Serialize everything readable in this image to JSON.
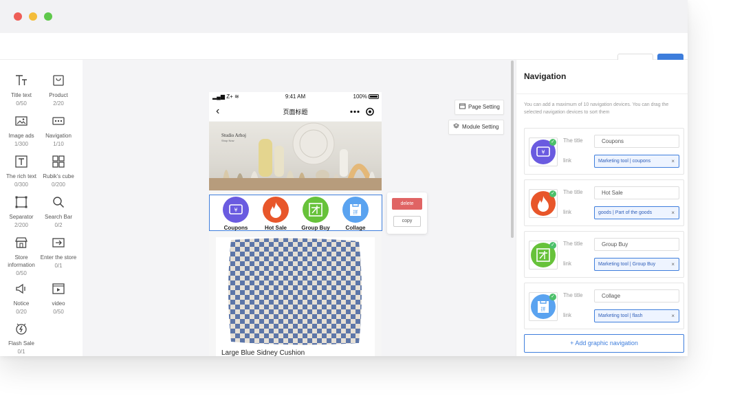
{
  "left_panel": {
    "components": [
      {
        "label": "Title text",
        "count": "0/50",
        "icon": "title-text-icon"
      },
      {
        "label": "Product",
        "count": "2/20",
        "icon": "product-icon"
      },
      {
        "label": "Image ads",
        "count": "1/300",
        "icon": "image-ads-icon"
      },
      {
        "label": "Navigation",
        "count": "1/10",
        "icon": "navigation-icon"
      },
      {
        "label": "The rich text",
        "count": "0/300",
        "icon": "rich-text-icon"
      },
      {
        "label": "Rubik's cube",
        "count": "0/200",
        "icon": "rubiks-cube-icon"
      },
      {
        "label": "Separator",
        "count": "2/200",
        "icon": "separator-icon"
      },
      {
        "label": "Search Bar",
        "count": "0/2",
        "icon": "search-icon"
      },
      {
        "label": "Store information",
        "count": "0/50",
        "icon": "store-icon"
      },
      {
        "label": "Enter the store",
        "count": "0/1",
        "icon": "enter-store-icon"
      },
      {
        "label": "Notice",
        "count": "0/20",
        "icon": "notice-icon"
      },
      {
        "label": "video",
        "count": "0/50",
        "icon": "video-icon"
      },
      {
        "label": "Flash Sale",
        "count": "0/1",
        "icon": "flash-sale-icon"
      }
    ]
  },
  "phone": {
    "status": {
      "signal": "Z+",
      "time": "9:41 AM",
      "battery": "100%"
    },
    "page_title": "页面标题",
    "banner": {
      "brand": "Studio Arhoj",
      "brand_sub": "Shop Now"
    },
    "nav_items": [
      {
        "label": "Coupons",
        "color": "#6a5be0",
        "glyph": "券"
      },
      {
        "label": "Hot Sale",
        "color": "#e8562a",
        "glyph": "🔥"
      },
      {
        "label": "Group Buy",
        "color": "#67c23a",
        "glyph": "团"
      },
      {
        "label": "Collage",
        "color": "#5aa3f0",
        "glyph": "拼"
      }
    ],
    "product": {
      "name": "Large Blue Sidney Cushion"
    }
  },
  "actions": {
    "delete": "delete",
    "copy": "copy"
  },
  "side_buttons": {
    "page_setting": "Page Setting",
    "module_setting": "Module Setting"
  },
  "right_panel": {
    "title": "Navigation",
    "hint": "You can add a maximum of 10 navigation devices. You can drag the selected navigation devices to sort them",
    "title_label": "The title",
    "link_label": "link",
    "cards": [
      {
        "title": "Coupons",
        "link": "Marketing tool | coupons",
        "color": "#6a5be0",
        "glyph": "券"
      },
      {
        "title": "Hot Sale",
        "link": "goods | Part of the goods",
        "color": "#e8562a",
        "glyph": "🔥"
      },
      {
        "title": "Group Buy",
        "link": "Marketing tool | Group Buy",
        "color": "#67c23a",
        "glyph": "团"
      },
      {
        "title": "Collage",
        "link": "Marketing tool | flash",
        "color": "#5aa3f0",
        "glyph": "拼"
      }
    ],
    "add_button": "+ Add graphic navigation"
  }
}
